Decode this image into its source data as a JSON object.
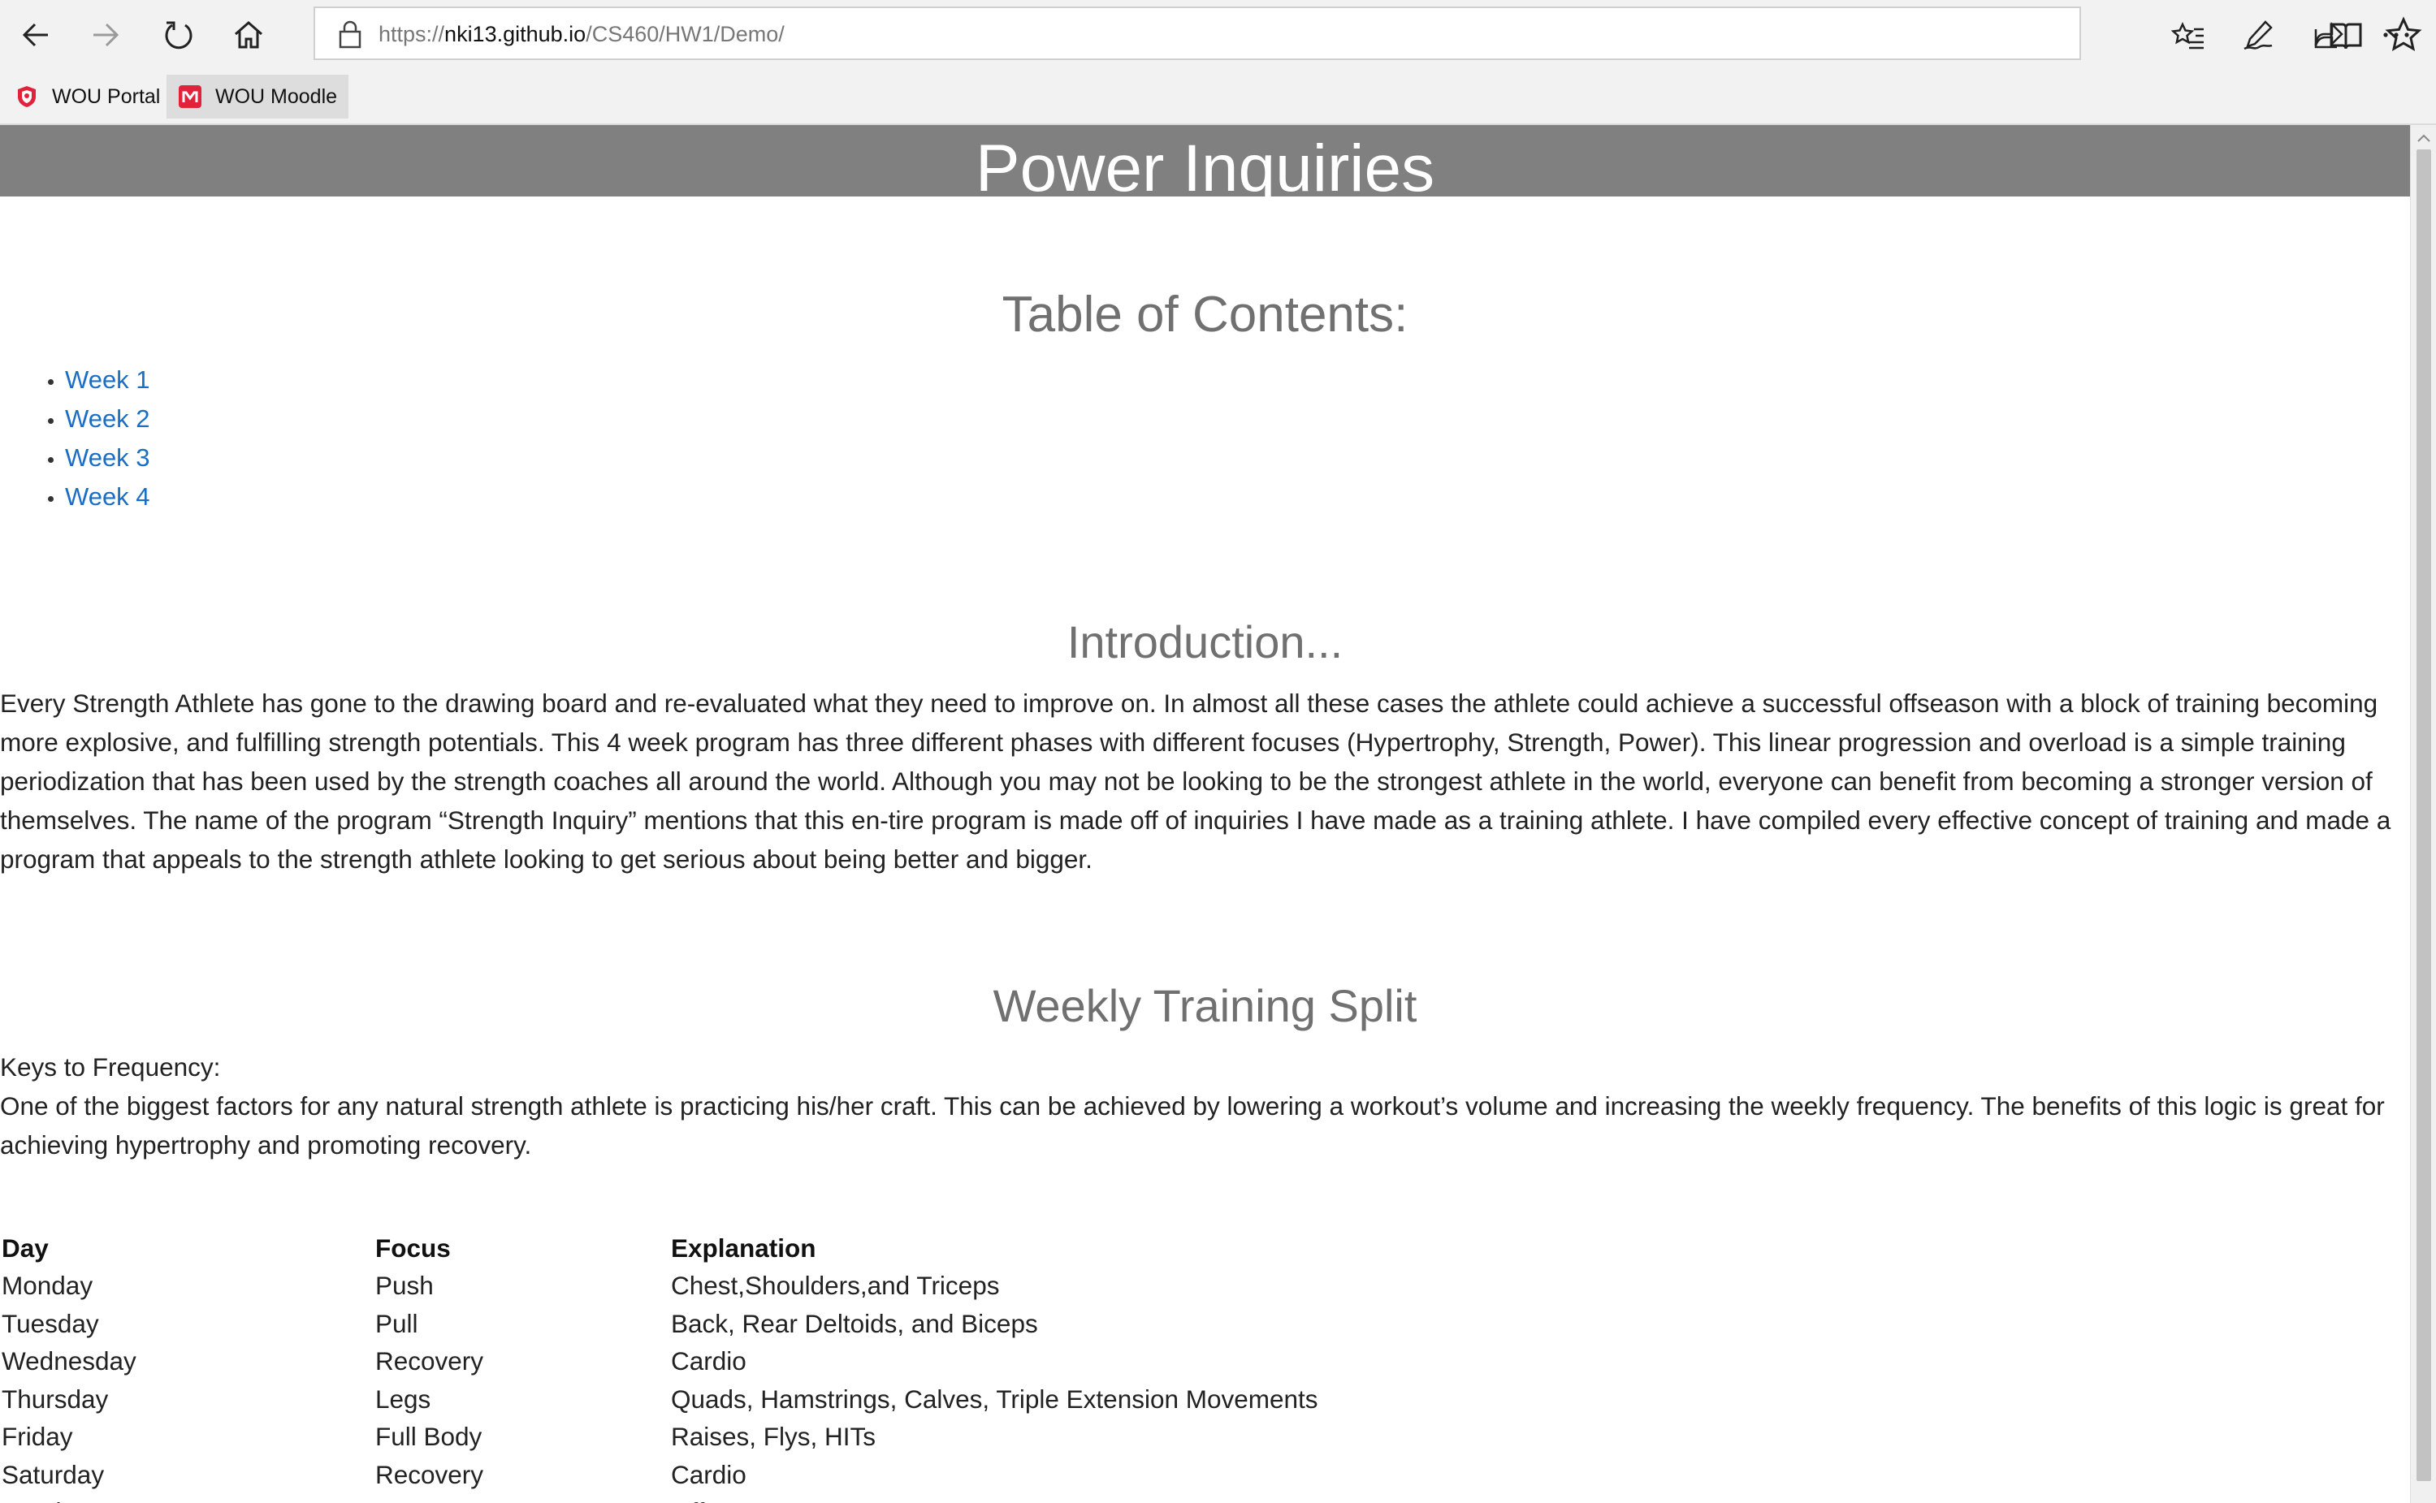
{
  "browser": {
    "url_scheme": "https://",
    "url_host": "nki13.github.io",
    "url_path": "/CS460/HW1/Demo/",
    "favorites": [
      {
        "label": "WOU Portal",
        "icon": "shield-icon"
      },
      {
        "label": "WOU Moodle",
        "icon": "moodle-m-icon"
      }
    ],
    "toolbar_icons": [
      "back-arrow-icon",
      "forward-arrow-icon",
      "refresh-icon",
      "home-icon",
      "lock-icon",
      "reading-view-icon",
      "star-icon",
      "favorites-icon",
      "pen-icon",
      "share-icon",
      "more-icon"
    ],
    "colors": {
      "chrome_bg": "#f2f2f2",
      "banner_bg": "#808080",
      "link": "#1a6fc4",
      "moodle_red": "#e2223a"
    }
  },
  "page": {
    "title": "Power Inquiries",
    "toc": {
      "heading": "Table of Contents:",
      "items": [
        "Week 1",
        "Week 2",
        "Week 3",
        "Week 4"
      ]
    },
    "intro": {
      "heading": "Introduction...",
      "text": "Every Strength Athlete has gone to the drawing board and re-evaluated what they need to improve on. In almost all these cases the athlete could achieve a successful offseason with a block of training becoming more explosive, and fulfilling strength potentials. This 4 week program has three different phases with different focuses (Hypertrophy, Strength, Power). This linear progression and overload is a simple training periodization that has been used by the strength coaches all around the world. Although you may not be looking to be the strongest athlete in the world, everyone can benefit from becoming a stronger version of themselves. The name of the program “Strength Inquiry” mentions that this en-tire program is made off of inquiries I have made as a training athlete. I have compiled every effective concept of training and made a program that appeals to the strength athlete looking to get serious about being better and bigger."
    },
    "split": {
      "heading": "Weekly Training Split",
      "keys_title": "Keys to Frequency:",
      "keys_text": "One of the biggest factors for any natural strength athlete is practicing his/her craft. This can be achieved by lowering a workout’s volume and increasing the weekly frequency. The benefits of this logic is great for achieving hypertrophy and promoting recovery.",
      "table": {
        "headers": [
          "Day",
          "Focus",
          "Explanation"
        ],
        "rows": [
          [
            "Monday",
            "Push",
            "Chest,Shoulders,and Triceps"
          ],
          [
            "Tuesday",
            "Pull",
            "Back, Rear Deltoids, and Biceps"
          ],
          [
            "Wednesday",
            "Recovery",
            "Cardio"
          ],
          [
            "Thursday",
            "Legs",
            "Quads, Hamstrings, Calves, Triple Extension Movements"
          ],
          [
            "Friday",
            "Full Body",
            "Raises, Flys, HITs"
          ],
          [
            "Saturday",
            "Recovery",
            "Cardio"
          ],
          [
            "Sunday",
            "Rest",
            "Off Day"
          ]
        ]
      }
    }
  }
}
